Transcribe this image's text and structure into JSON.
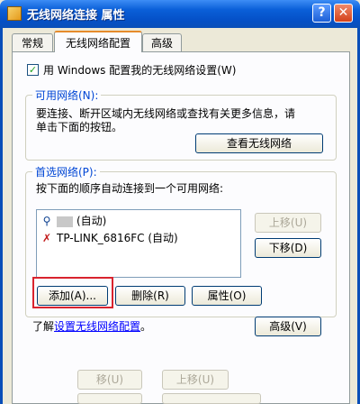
{
  "window": {
    "title": "无线网络连接  属性",
    "help_glyph": "?",
    "close_glyph": "✕"
  },
  "tabs": [
    {
      "label": "常规"
    },
    {
      "label": "无线网络配置"
    },
    {
      "label": "高级"
    }
  ],
  "windows_config_checkbox": {
    "label": "用 Windows 配置我的无线网络设置(W)",
    "checked": true,
    "mark": "✓"
  },
  "available_networks": {
    "legend": "可用网络(N):",
    "description_line1": "要连接、断开区域内无线网络或查找有关更多信息，请",
    "description_line2": "单击下面的按钮。",
    "view_button": "查看无线网络"
  },
  "preferred_networks": {
    "legend": "首选网络(P):",
    "description": "按下面的顺序自动连接到一个可用网络:",
    "networks": [
      {
        "name": "(自动)",
        "icon": "wifi-key-icon"
      },
      {
        "name": "TP-LINK_6816FC (自动)",
        "icon": "wifi-x-icon"
      }
    ],
    "move_up_button": "上移(U)",
    "move_down_button": "下移(D)",
    "add_button": "添加(A)...",
    "remove_button": "删除(R)",
    "properties_button": "属性(O)"
  },
  "footer": {
    "learn_prefix": "了解",
    "learn_link": "设置无线网络配置",
    "learn_suffix": "。",
    "advanced_button": "高级(V)"
  },
  "ghost_buttons": [
    "移(U)",
    "上移(U)"
  ],
  "colors": {
    "highlight_box": "#d9232e",
    "titlebar": "#0a5fd8",
    "link": "#0000ff"
  }
}
